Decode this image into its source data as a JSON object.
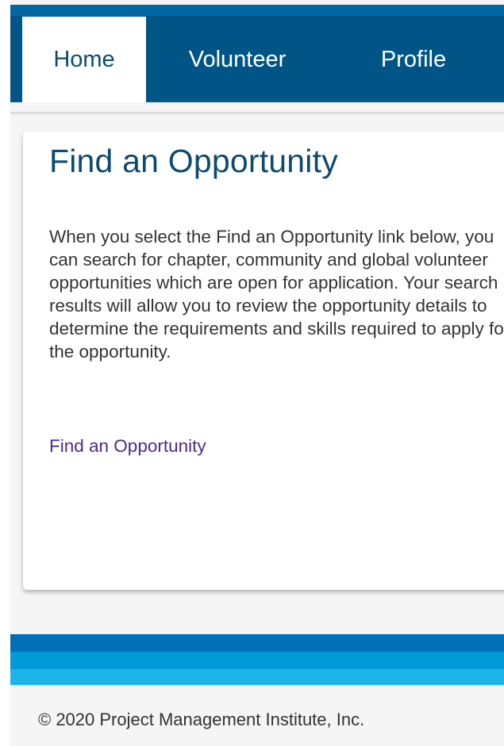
{
  "nav": {
    "tabs": [
      {
        "label": "Home",
        "active": true
      },
      {
        "label": "Volunteer",
        "active": false
      },
      {
        "label": "Profile",
        "active": false
      }
    ]
  },
  "card": {
    "title": "Find an Opportunity",
    "description": "When you select the Find an Opportunity link below, you can search for chapter, community and global volunteer opportunities which are open for application. Your search results will allow you to review the opportunity details to determine the requirements and skills required to apply for the opportunity.",
    "link_label": "Find an Opportunity"
  },
  "footer": {
    "copyright": "© 2020 Project Management Institute, Inc."
  },
  "colors": {
    "nav_background": "#005587",
    "title_color": "#0d4a72",
    "link_color": "#4a2a8c",
    "footer_stripe_dark": "#0070b8",
    "footer_stripe_mid": "#009ad9",
    "footer_stripe_light": "#1db4ea"
  }
}
